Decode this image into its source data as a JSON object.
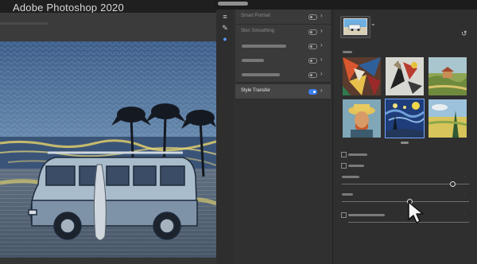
{
  "app": {
    "title": "Adobe Photoshop 2020"
  },
  "filters": {
    "items": [
      {
        "label": "Smart Portrait",
        "enabled": false
      },
      {
        "label": "Skin Smoothing",
        "enabled": false
      },
      {
        "label": "",
        "enabled": false
      },
      {
        "label": "",
        "enabled": false
      },
      {
        "label": "",
        "enabled": false
      },
      {
        "label": "Style Transfer",
        "enabled": true
      }
    ]
  },
  "style_transfer": {
    "styles": [
      {
        "name": "cubist-abstract",
        "selected": false
      },
      {
        "name": "abstract-figures",
        "selected": false
      },
      {
        "name": "landscape-painting",
        "selected": false
      },
      {
        "name": "van-gogh-self-portrait",
        "selected": false
      },
      {
        "name": "starry-night",
        "selected": true
      },
      {
        "name": "wheat-field",
        "selected": false
      }
    ]
  },
  "icons": {
    "reset": "reset-icon",
    "chevron": "chevron-right-icon",
    "dropdown": "chevron-down-icon"
  },
  "colors": {
    "accent": "#3b7ef0",
    "selected_border": "#6fa6ff"
  }
}
